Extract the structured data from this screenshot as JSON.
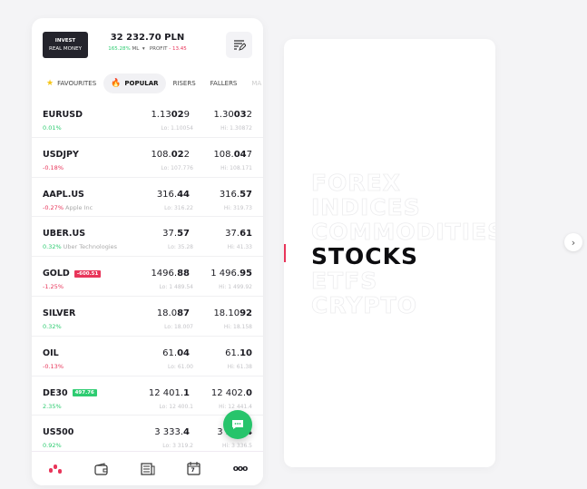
{
  "header": {
    "invest_line1": "INVEST",
    "invest_line2": "REAL MONEY",
    "balance": "32 232.70 PLN",
    "margin_level": "165.28%",
    "ml_label": "ML",
    "profit_label": "PROFIT",
    "profit_value": "- 13.45"
  },
  "tabs": [
    {
      "label": "FAVOURITES",
      "icon": "star-icon"
    },
    {
      "label": "POPULAR",
      "icon": "flame-icon",
      "active": true
    },
    {
      "label": "RISERS"
    },
    {
      "label": "FALLERS"
    },
    {
      "label": "MA"
    }
  ],
  "instruments": [
    {
      "symbol": "EURUSD",
      "change": "0.01%",
      "dir": "up",
      "desc": "",
      "badge": "",
      "bid": [
        "1.13",
        "02",
        "9"
      ],
      "ask": [
        "1.30",
        "03",
        "2"
      ],
      "lo": "Lo: 1.10054",
      "hi": "Hi: 1.30872"
    },
    {
      "symbol": "USDJPY",
      "change": "-0.18%",
      "dir": "down",
      "desc": "",
      "badge": "",
      "bid": [
        "108.",
        "02",
        "2"
      ],
      "ask": [
        "108.",
        "04",
        "7"
      ],
      "lo": "Lo: 107.776",
      "hi": "Hi: 108.171"
    },
    {
      "symbol": "AAPL.US",
      "change": "-0.27%",
      "dir": "down",
      "desc": "Apple Inc",
      "badge": "",
      "bid": [
        "316.",
        "44",
        ""
      ],
      "ask": [
        "316.",
        "57",
        ""
      ],
      "lo": "Lo: 316.22",
      "hi": "Hi: 319.73"
    },
    {
      "symbol": "UBER.US",
      "change": "0.32%",
      "dir": "up",
      "desc": "Uber Technologies",
      "badge": "",
      "bid": [
        "37.",
        "57",
        ""
      ],
      "ask": [
        "37.",
        "61",
        ""
      ],
      "lo": "Lo: 35.28",
      "hi": "Hi: 41.33"
    },
    {
      "symbol": "GOLD",
      "change": "-1.25%",
      "dir": "down",
      "desc": "",
      "badge": "-600.51",
      "bid": [
        "1496.",
        "88",
        ""
      ],
      "ask": [
        "1 496.",
        "95",
        ""
      ],
      "lo": "Lo: 1 489.54",
      "hi": "Hi: 1 499.92"
    },
    {
      "symbol": "SILVER",
      "change": "0.32%",
      "dir": "up",
      "desc": "",
      "badge": "",
      "bid": [
        "18.0",
        "87",
        ""
      ],
      "ask": [
        "18.10",
        "92",
        ""
      ],
      "lo": "Lo: 18.007",
      "hi": "Hi: 18.158"
    },
    {
      "symbol": "OIL",
      "change": "-0.13%",
      "dir": "down",
      "desc": "",
      "badge": "",
      "bid": [
        "61.",
        "04",
        ""
      ],
      "ask": [
        "61.",
        "10",
        ""
      ],
      "lo": "Lo: 61.00",
      "hi": "Hi: 61.38"
    },
    {
      "symbol": "DE30",
      "change": "2.35%",
      "dir": "up",
      "desc": "",
      "badge": "497.76",
      "bid": [
        "12 401.",
        "1",
        ""
      ],
      "ask": [
        "12 402.",
        "0",
        ""
      ],
      "lo": "Lo: 12 400.1",
      "hi": "Hi: 12 441.4"
    },
    {
      "symbol": "US500",
      "change": "0.92%",
      "dir": "up",
      "desc": "",
      "badge": "",
      "bid": [
        "3 333.",
        "4",
        ""
      ],
      "ask": [
        "3 333.",
        "4",
        ""
      ],
      "lo": "Lo: 3 319.2",
      "hi": "Hi: 3 336.5"
    }
  ],
  "nav": [
    "market-icon",
    "wallet-icon",
    "news-icon",
    "calendar-icon",
    "more-icon"
  ],
  "calendar_day": "7",
  "categories": [
    {
      "label": "FOREX"
    },
    {
      "label": "INDICES"
    },
    {
      "label": "COMMODITIES"
    },
    {
      "label": "STOCKS",
      "active": true
    },
    {
      "label": "ETFS"
    },
    {
      "label": "CRYPTO"
    }
  ],
  "colors": {
    "up": "#2ecc71",
    "down": "#e8355a",
    "accent": "#e8355a",
    "fab": "#27c46b"
  }
}
